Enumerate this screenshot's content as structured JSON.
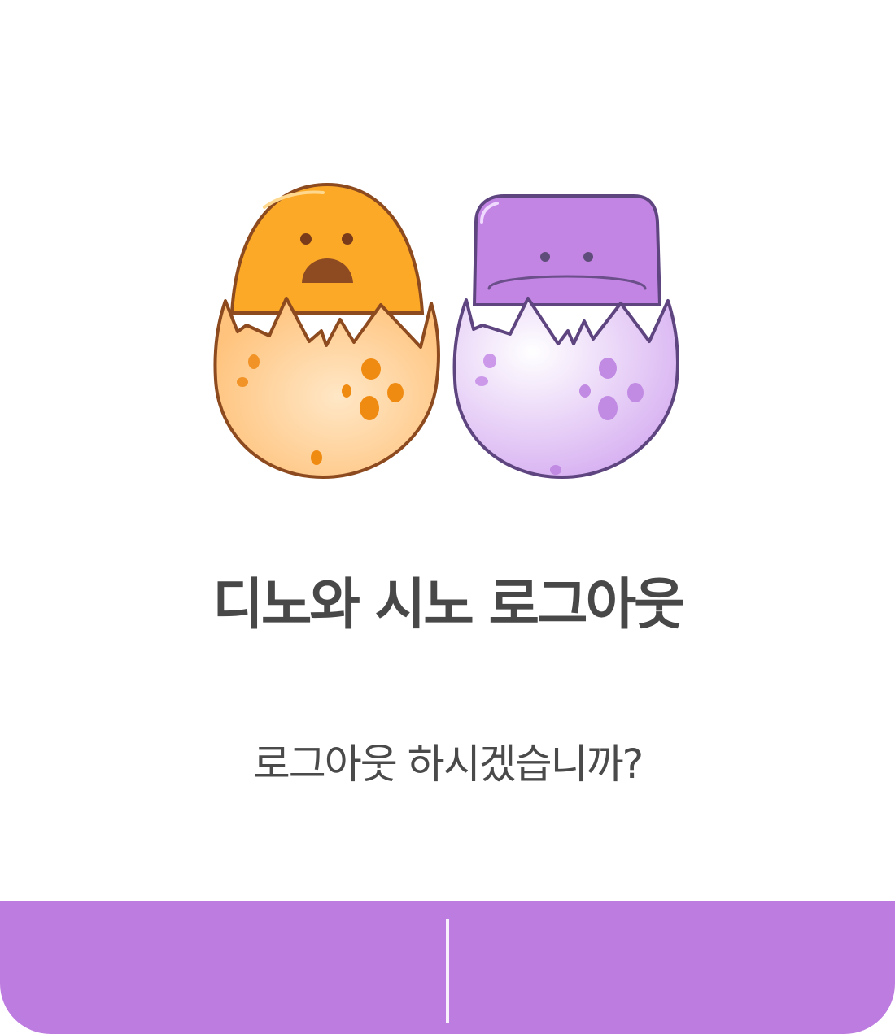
{
  "dialog": {
    "title": "디노와 시노 로그아웃",
    "message": "로그아웃 하시겠습니까?",
    "accent_color": "#bd7ce0",
    "buttons": {
      "cancel_label": "",
      "confirm_label": ""
    }
  },
  "illustration": {
    "left_character": {
      "icon": "orange-dino-egg-icon",
      "color": "#fba927"
    },
    "right_character": {
      "icon": "purple-dino-egg-icon",
      "color": "#c385e3"
    }
  }
}
